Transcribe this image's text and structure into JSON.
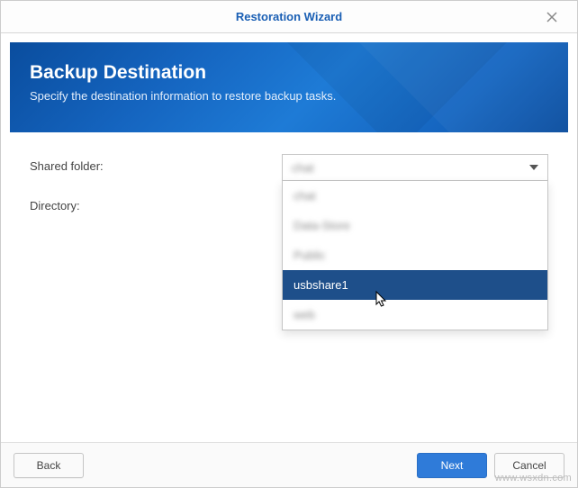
{
  "window": {
    "title": "Restoration Wizard"
  },
  "banner": {
    "heading": "Backup Destination",
    "subheading": "Specify the destination information to restore backup tasks."
  },
  "form": {
    "shared_folder_label": "Shared folder:",
    "directory_label": "Directory:",
    "shared_folder_value": "chat"
  },
  "dropdown": {
    "items": [
      {
        "label": "chat",
        "blurred": true
      },
      {
        "label": "Data-Store",
        "blurred": true
      },
      {
        "label": "Public",
        "blurred": true
      },
      {
        "label": "usbshare1",
        "blurred": false,
        "highlight": true
      },
      {
        "label": "web",
        "blurred": true
      }
    ]
  },
  "footer": {
    "back": "Back",
    "next": "Next",
    "cancel": "Cancel"
  },
  "watermark": "www.wsxdn.com"
}
